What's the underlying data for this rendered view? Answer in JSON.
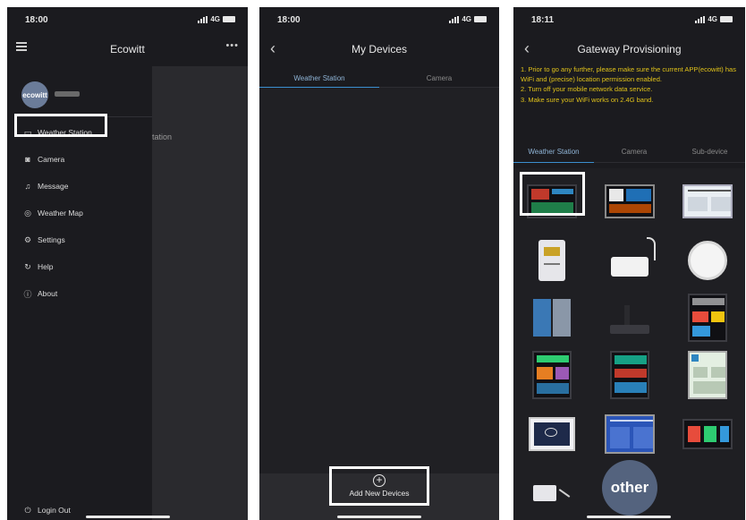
{
  "phones": [
    {
      "status_time": "18:00",
      "status_net": "4G",
      "app_title": "Ecowitt",
      "user": {
        "avatar_text": "ecowitt"
      },
      "peek_text": "tation",
      "menu": [
        {
          "label": "Weather Station",
          "icon": "monitor-icon"
        },
        {
          "label": "Camera",
          "icon": "camera-icon"
        },
        {
          "label": "Message",
          "icon": "bell-icon"
        },
        {
          "label": "Weather Map",
          "icon": "map-icon"
        },
        {
          "label": "Settings",
          "icon": "gear-icon"
        },
        {
          "label": "Help",
          "icon": "help-icon"
        },
        {
          "label": "About",
          "icon": "info-icon"
        }
      ],
      "logout": "Login Out"
    },
    {
      "status_time": "18:00",
      "status_net": "4G",
      "title": "My Devices",
      "tabs": [
        "Weather Station",
        "Camera"
      ],
      "add_button": "Add New Devices"
    },
    {
      "status_time": "18:11",
      "status_net": "4G",
      "title": "Gateway Provisioning",
      "notice": "1. Prior to go any further, please make sure the current APP(ecowitt) has WiFi and (precise) location permission enabled.\n2. Turn off your mobile network data service.\n3. Make sure your WiFi works on 2.4G band.",
      "tabs": [
        "Weather Station",
        "Camera",
        "Sub-device"
      ],
      "other_label": "other"
    }
  ],
  "colors": {
    "accent": "#3b8fcf",
    "notice": "#e0c21a",
    "background": "#1b1b1f",
    "highlight": "#ffffff"
  }
}
